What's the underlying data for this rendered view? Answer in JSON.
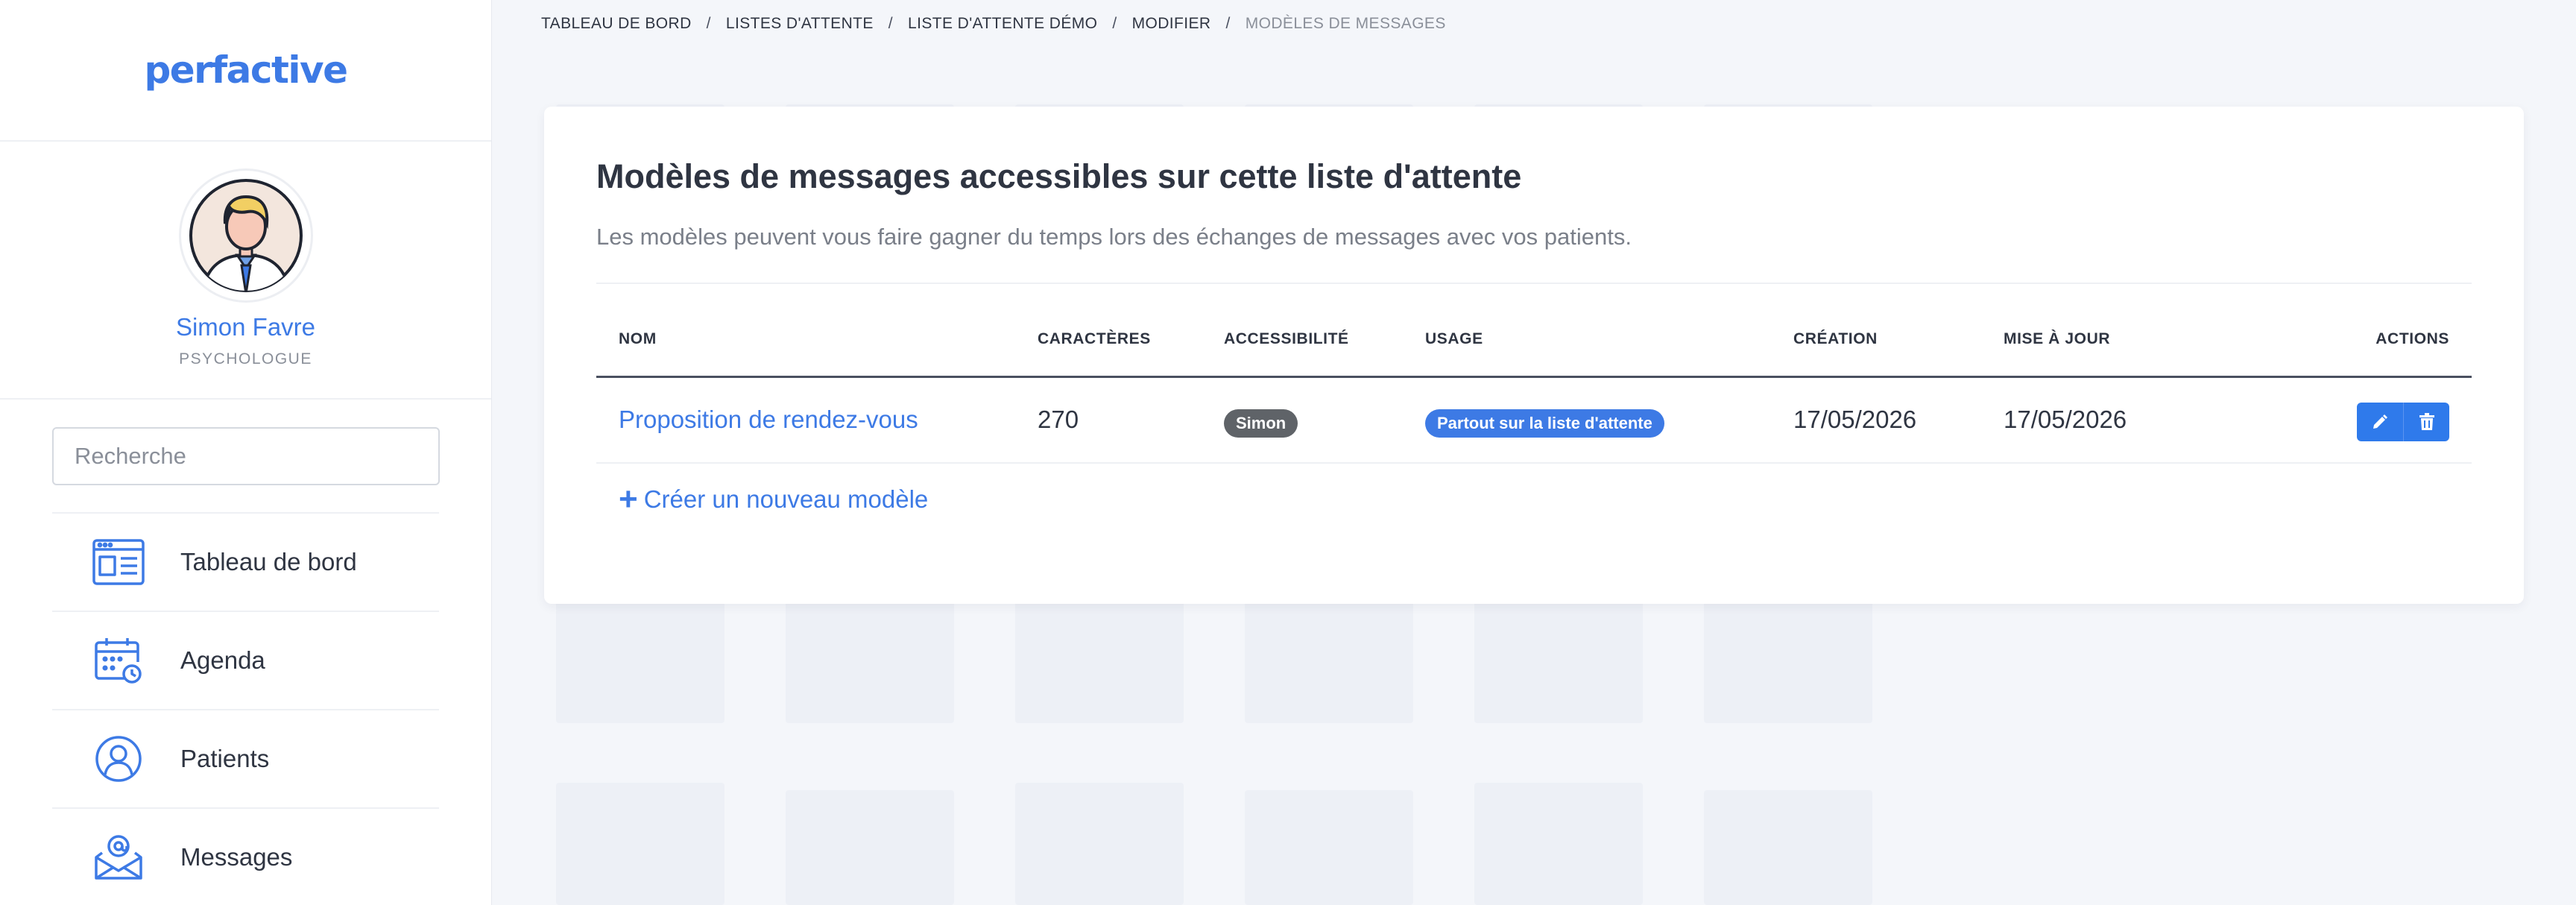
{
  "brand": {
    "logo": "perfactive",
    "accent_color": "#3d7ae5"
  },
  "profile": {
    "name": "Simon Favre",
    "role": "PSYCHOLOGUE",
    "avatar_icon": "user-avatar-icon"
  },
  "search": {
    "placeholder": "Recherche",
    "value": ""
  },
  "nav": {
    "items": [
      {
        "label": "Tableau de bord",
        "icon": "dashboard-icon"
      },
      {
        "label": "Agenda",
        "icon": "calendar-icon"
      },
      {
        "label": "Patients",
        "icon": "user-icon"
      },
      {
        "label": "Messages",
        "icon": "mail-icon"
      }
    ]
  },
  "breadcrumb": {
    "items": [
      "TABLEAU DE BORD",
      "LISTES D'ATTENTE",
      "LISTE D'ATTENTE DÉMO",
      "MODIFIER",
      "MODÈLES DE MESSAGES"
    ],
    "separator": "/"
  },
  "main": {
    "title": "Modèles de messages accessibles sur cette liste d'attente",
    "description": "Les modèles peuvent vous faire gagner du temps lors des échanges de messages avec vos patients.",
    "table": {
      "columns": [
        "NOM",
        "CARACTÈRES",
        "ACCESSIBILITÉ",
        "USAGE",
        "CRÉATION",
        "MISE À JOUR",
        "ACTIONS"
      ],
      "rows": [
        {
          "name": "Proposition de rendez-vous",
          "characters": "270",
          "accessibility": "Simon",
          "usage": "Partout sur la liste d'attente",
          "created": "17/05/2026",
          "updated": "17/05/2026",
          "actions": [
            "edit-icon",
            "trash-icon"
          ]
        }
      ]
    },
    "create_link": "Créer un nouveau modèle"
  }
}
